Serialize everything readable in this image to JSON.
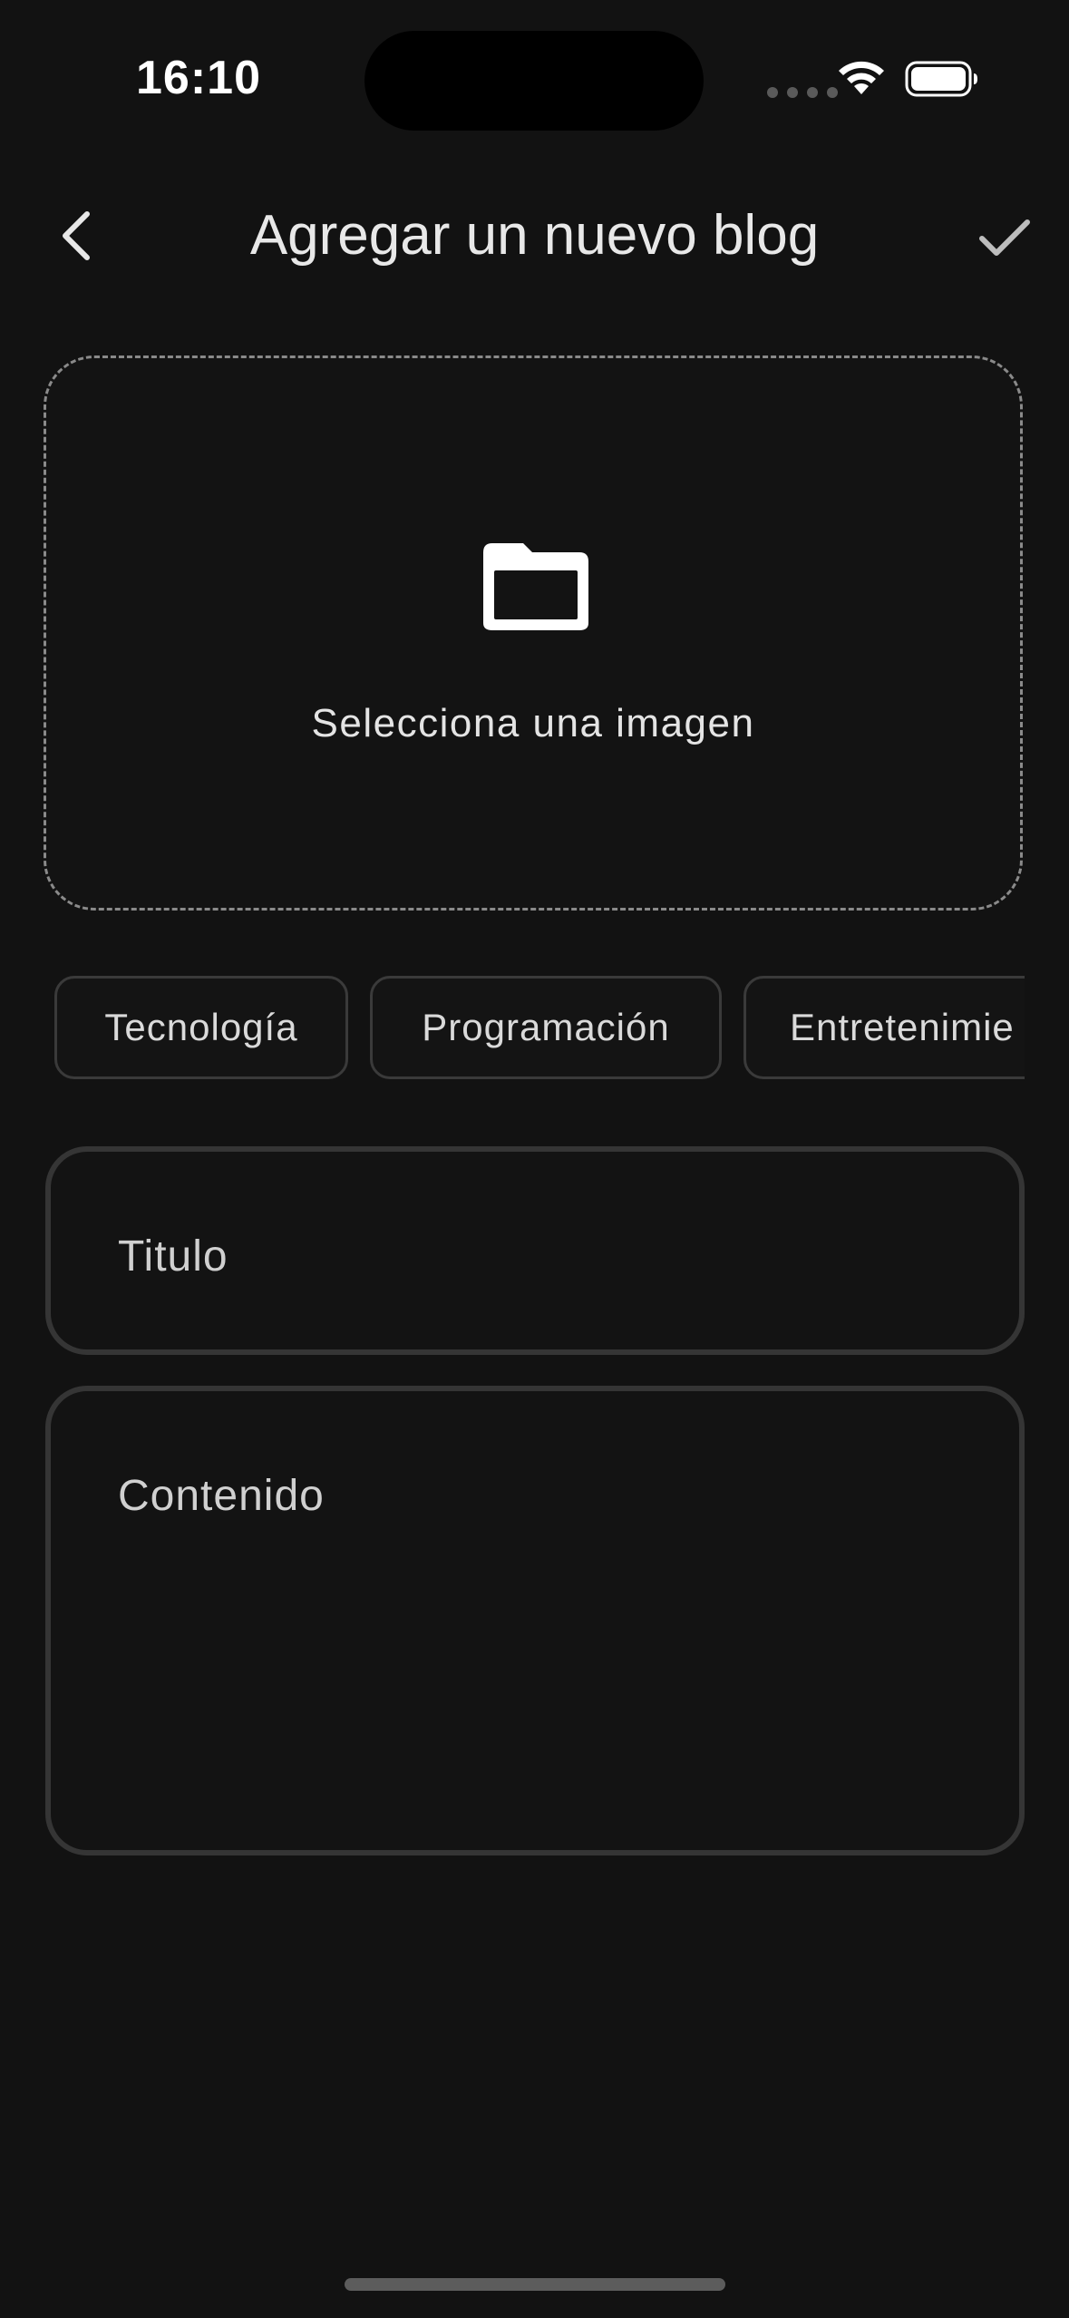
{
  "status_bar": {
    "time": "16:10",
    "wifi_icon": "wifi-icon",
    "battery_icon": "battery-icon"
  },
  "nav": {
    "back_icon": "chevron-left-icon",
    "title": "Agregar un nuevo blog",
    "confirm_icon": "checkmark-icon"
  },
  "image_picker": {
    "icon": "folder-icon",
    "label": "Selecciona una imagen"
  },
  "categories": [
    {
      "label": "Tecnología"
    },
    {
      "label": "Programación"
    },
    {
      "label": "Entretenimie"
    }
  ],
  "form": {
    "title_placeholder": "Titulo",
    "content_placeholder": "Contenido"
  },
  "colors": {
    "background": "#121212",
    "border": "#353535",
    "text": "#e6e6e6"
  }
}
